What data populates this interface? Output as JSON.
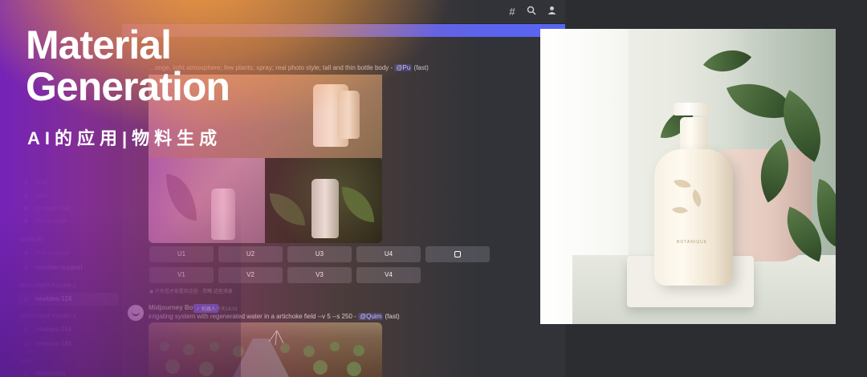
{
  "headline": {
    "line1": "Material",
    "line2": "Generation",
    "subtitle": "AI的应用|物料生成"
  },
  "topbar": {
    "icons": [
      "threads-icon",
      "search-icon",
      "members-icon"
    ]
  },
  "message1": {
    "prompt_fragment": "…ange, light atmosphere; few plants; spray; real photo style; tall and thin bottle body -",
    "mention": "@Pu",
    "speed": "(fast)",
    "buttons_row1": [
      "U1",
      "U2",
      "U3",
      "U4"
    ],
    "buttons_row2": [
      "V1",
      "V2",
      "V3",
      "V4"
    ],
    "reaction_note": "只有您才能看到这些 · 忽略 这些消息"
  },
  "message2": {
    "author": "Midjourney Bot",
    "tag": "✓ 机器人",
    "time": "今天16:01",
    "prompt": "irrigating system with regenerated water in a artichoke field --v 5 --s 250 -",
    "mention": "@Quim",
    "speed": "(fast)"
  },
  "sidebar": {
    "faded_items": [
      "chat",
      "help",
      "prompt-chat",
      "micro-code"
    ],
    "cat_support": "SUPPORT",
    "support_items": [
      "trial-support",
      "member-support"
    ],
    "cat_newcomer2": "NEWCOMER ROOMS 2",
    "newcomer2_items": [
      "newbies-124"
    ],
    "cat_newcomer4": "NEWCOMER ROOMS 4",
    "newcomer4_items": [
      "newbies-154",
      "newbies-184"
    ],
    "cat_chat": "CHAT",
    "chat_items": [
      "discussion"
    ]
  },
  "hero": {
    "bottle_label": "BOTANIQUE"
  },
  "colors": {
    "purple": "#7b22c4",
    "orange": "#f29e3e",
    "blurple": "#5865f2",
    "discord_bg": "#313338"
  }
}
